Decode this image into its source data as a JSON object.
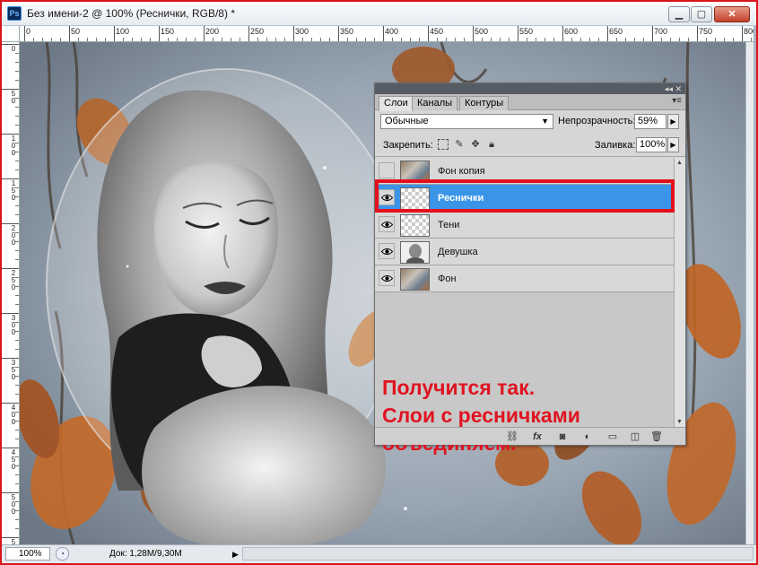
{
  "window": {
    "app_icon": "Ps",
    "title": "Без имени-2 @ 100% (Реснички, RGB/8) *",
    "controls": {
      "minimize": "▁",
      "maximize": "▢",
      "close": "✕"
    }
  },
  "rulers": {
    "top_labels": [
      "0",
      "50",
      "100",
      "150",
      "200",
      "250",
      "300",
      "350",
      "400",
      "450",
      "500",
      "550",
      "600",
      "650",
      "700",
      "750",
      "800"
    ],
    "left_labels": [
      "0",
      "50",
      "100",
      "150",
      "200",
      "250",
      "300",
      "350",
      "400",
      "450",
      "500",
      "550"
    ]
  },
  "status_bar": {
    "zoom": "100%",
    "doc_info": "Док: 1,28M/9,30M"
  },
  "layers_panel": {
    "tabs": [
      "Слои",
      "Каналы",
      "Контуры"
    ],
    "active_tab": "Слои",
    "blend_mode": "Обычные",
    "opacity_label": "Непрозрачность:",
    "opacity_value": "59%",
    "lock_label": "Закрепить:",
    "fill_label": "Заливка:",
    "fill_value": "100%",
    "layers": [
      {
        "name": "Фон копия",
        "visible": false,
        "selected": false,
        "thumb": "photo"
      },
      {
        "name": "Реснички",
        "visible": true,
        "selected": true,
        "thumb": "checker"
      },
      {
        "name": "Тени",
        "visible": true,
        "selected": false,
        "thumb": "checker"
      },
      {
        "name": "Девушка",
        "visible": true,
        "selected": false,
        "thumb": "girl"
      },
      {
        "name": "Фон",
        "visible": true,
        "selected": false,
        "thumb": "photo"
      }
    ],
    "bottom_icons": [
      "link-icon",
      "fx-icon",
      "mask-icon",
      "adjustment-icon",
      "group-folder-icon",
      "new-layer-icon",
      "trash-icon"
    ]
  },
  "annotation": {
    "line1": "Получится так.",
    "line2": "Слои с ресничками",
    "line3": "объединяем.",
    "color": "#e01320"
  },
  "colors": {
    "selection": "#3a95e8",
    "frame": "#e3101c"
  }
}
